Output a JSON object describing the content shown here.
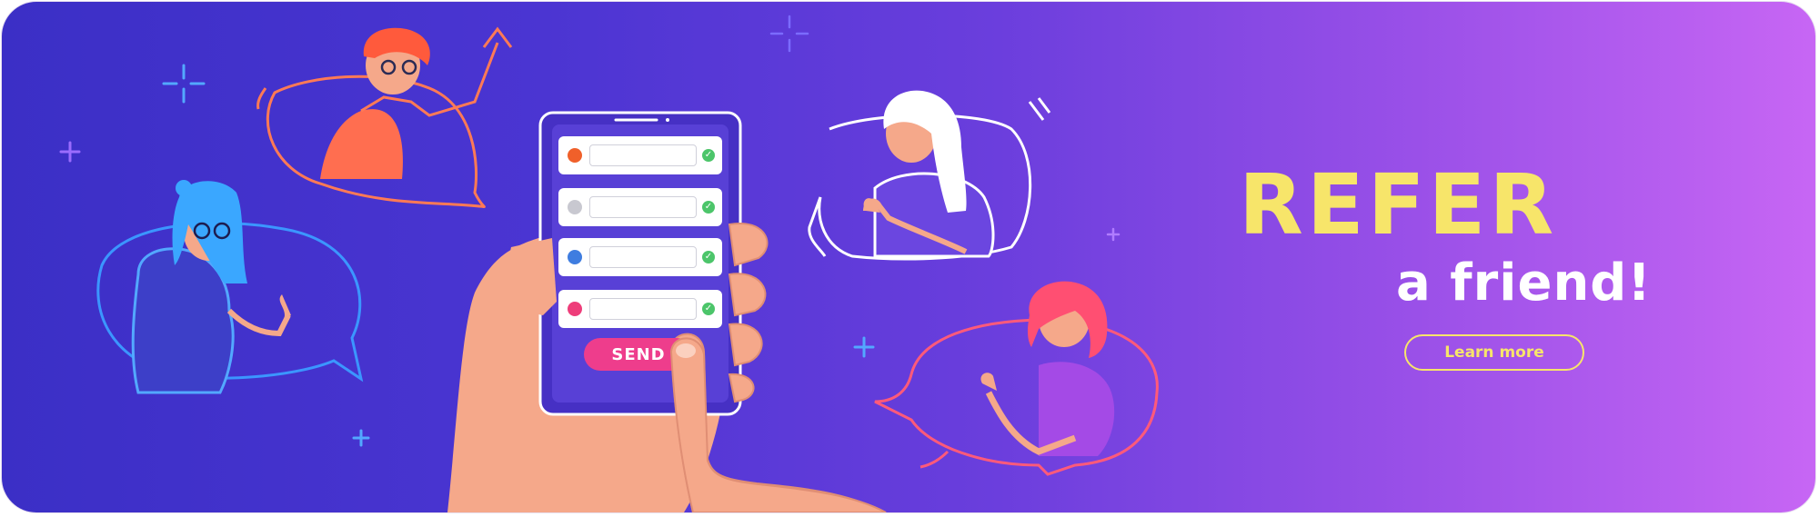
{
  "banner": {
    "headline": "REFER",
    "subline": "a friend!",
    "cta_label": "Learn more"
  },
  "phone": {
    "send_label": "SEND",
    "messages": [
      {
        "avatar_color": "#f0602a"
      },
      {
        "avatar_color": "#c8c8d0"
      },
      {
        "avatar_color": "#3f7de0"
      },
      {
        "avatar_color": "#ee3d7a"
      }
    ]
  },
  "colors": {
    "accent_yellow": "#f7e56a",
    "send_button": "#ee3d8c",
    "check_green": "#4cc56a",
    "skin": "#f5a88a"
  },
  "icons": [
    "sparkle-icon",
    "plus-icon",
    "check-icon",
    "thumbs-up-icon"
  ]
}
